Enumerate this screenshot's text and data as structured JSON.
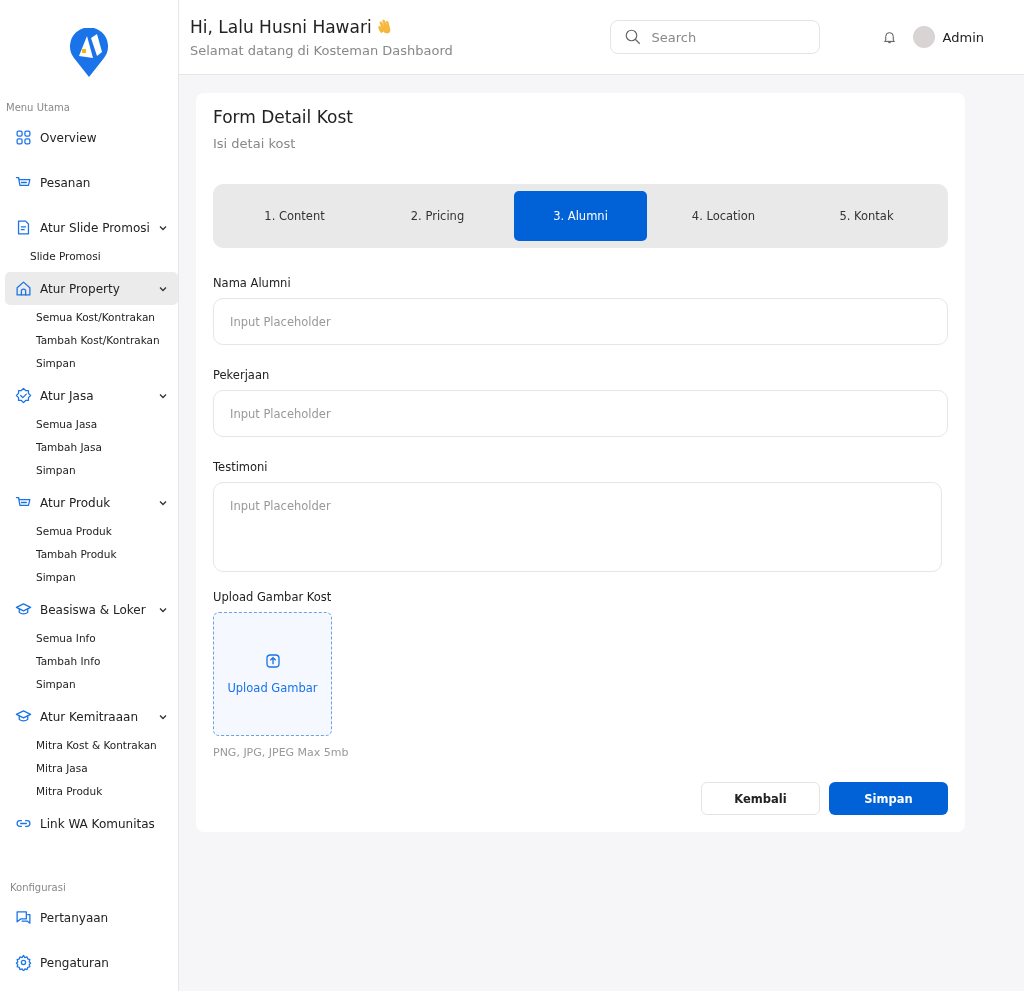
{
  "sidebar": {
    "sections": [
      {
        "title": "Menu Utama",
        "items": [
          {
            "kind": "link",
            "label": "Overview",
            "selected": false
          },
          {
            "kind": "link",
            "label": "Pesanan",
            "selected": false
          },
          {
            "kind": "group",
            "label": "Atur Slide Promosi",
            "selected": false,
            "expanded": true,
            "children": [
              {
                "label": "Slide Promosi"
              }
            ]
          },
          {
            "kind": "group",
            "label": "Atur Property",
            "selected": true,
            "expanded": true,
            "children": [
              {
                "label": "Semua Kost/Kontrakan"
              },
              {
                "label": "Tambah Kost/Kontrakan"
              },
              {
                "label": "Simpan"
              }
            ]
          },
          {
            "kind": "group",
            "label": "Atur Jasa",
            "selected": false,
            "expanded": true,
            "children": [
              {
                "label": "Semua Jasa"
              },
              {
                "label": "Tambah Jasa"
              },
              {
                "label": "Simpan"
              }
            ]
          },
          {
            "kind": "group",
            "label": "Atur Produk",
            "selected": false,
            "expanded": true,
            "children": [
              {
                "label": "Semua Produk"
              },
              {
                "label": "Tambah Produk"
              },
              {
                "label": "Simpan"
              }
            ]
          },
          {
            "kind": "group",
            "label": "Beasiswa & Loker",
            "selected": false,
            "expanded": true,
            "children": [
              {
                "label": "Semua Info"
              },
              {
                "label": "Tambah Info"
              },
              {
                "label": "Simpan"
              }
            ]
          },
          {
            "kind": "group",
            "label": "Atur Kemitraaan",
            "selected": false,
            "expanded": true,
            "children": [
              {
                "label": "Mitra Kost & Kontrakan"
              },
              {
                "label": "Mitra Jasa"
              },
              {
                "label": "Mitra Produk"
              }
            ]
          },
          {
            "kind": "link",
            "label": "Link WA Komunitas",
            "selected": false
          }
        ]
      },
      {
        "title": "Konfigurasi",
        "items": [
          {
            "kind": "link",
            "label": "Pertanyaan",
            "selected": false
          },
          {
            "kind": "link",
            "label": "Pengaturan",
            "selected": false
          }
        ]
      }
    ]
  },
  "header": {
    "greeting": "Hi, Lalu Husni Hawari",
    "subtitle": "Selamat datang di Kosteman Dashbaord",
    "search": {
      "placeholder": "Search"
    },
    "user": "Admin"
  },
  "form": {
    "title": "Form Detail Kost",
    "subtitle": "Isi detai kost",
    "steps": [
      {
        "label": "1. Content",
        "selected": false
      },
      {
        "label": "2. Pricing",
        "selected": false
      },
      {
        "label": "3. Alumni",
        "selected": true
      },
      {
        "label": "4. Location",
        "selected": false
      },
      {
        "label": "5. Kontak",
        "selected": false
      }
    ],
    "fields": [
      {
        "kind": "input",
        "label": "Nama Alumni",
        "placeholder": "Input Placeholder"
      },
      {
        "kind": "input",
        "label": "Pekerjaan",
        "placeholder": "Input Placeholder"
      },
      {
        "kind": "textarea",
        "label": "Testimoni",
        "placeholder": "Input Placeholder"
      }
    ],
    "upload": {
      "label": "Upload Gambar Kost",
      "button": "Upload Gambar",
      "hint": "PNG, JPG, JPEG Max 5mb"
    },
    "buttons": [
      {
        "kind": "secondary",
        "label": "Kembali"
      },
      {
        "kind": "primary",
        "label": "Simpan"
      }
    ]
  }
}
